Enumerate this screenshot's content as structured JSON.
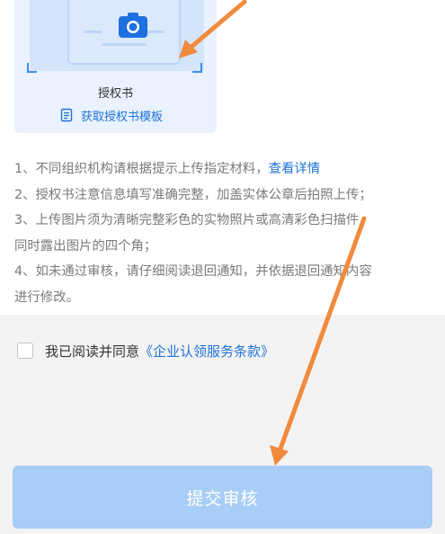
{
  "upload_card": {
    "title": "授权书",
    "template_link": "获取授权书模板"
  },
  "notes": {
    "line1_text": "1、不同组织机构请根据提示上传指定材料，",
    "line1_link": "查看详情",
    "line2": "2、授权书注意信息填写准确完整，加盖实体公章后拍照上传；",
    "line3a": "3、上传图片须为清晰完整彩色的实物照片或高清彩色扫描件，",
    "line3b": "同时露出图片的四个角；",
    "line4a": "4、如未通过审核，请仔细阅读退回通知，并依据退回通知内容",
    "line4b": "进行修改。"
  },
  "agreement": {
    "prefix": "我已阅读并同意",
    "terms_link": "《企业认领服务条款》",
    "checked": false
  },
  "submit_button": {
    "label": "提交审核",
    "enabled": false
  },
  "colors": {
    "accent": "#1f73d6",
    "button_disabled": "#a8cdf6",
    "card_bg": "#e9f2fe",
    "annotation_arrow": "#f08a3c"
  },
  "icons": {
    "upload": "camera-icon",
    "template": "document-icon",
    "annotation": "arrow-icon"
  }
}
